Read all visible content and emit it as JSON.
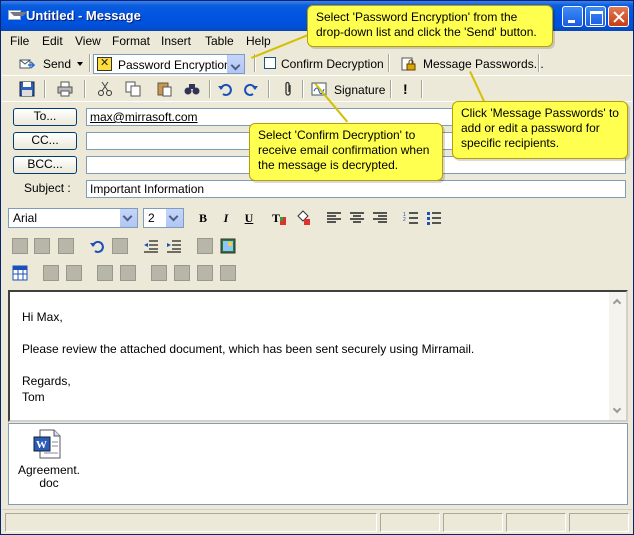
{
  "window": {
    "title": "Untitled - Message"
  },
  "menu": [
    "File",
    "Edit",
    "View",
    "Format",
    "Insert",
    "Table",
    "Help"
  ],
  "toolbar": {
    "send_label": "Send",
    "encryption_selected": "Password Encryption",
    "confirm_decryption_label": "Confirm Decryption",
    "confirm_decryption_checked": false,
    "message_passwords_label": "Message Passwords...",
    "signature_label": "Signature",
    "priority_label": "!"
  },
  "fields": {
    "to_label": "To...",
    "cc_label": "CC...",
    "bcc_label": "BCC...",
    "subject_label": "Subject :",
    "to_value": "max@mirrasoft.com",
    "cc_value": "",
    "bcc_value": "",
    "subject_value": "Important Information"
  },
  "format": {
    "font": "Arial",
    "size": "2",
    "bold": "B",
    "italic": "I",
    "underline": "U"
  },
  "body": {
    "greeting": "Hi Max,",
    "line1": "Please review the attached document, which has been sent securely using Mirramail.",
    "closing": "Regards,",
    "signature": "Tom"
  },
  "attachment": {
    "name": "Agreement.doc"
  },
  "callouts": {
    "encryption": "Select 'Password Encryption' from the drop-down list and click the 'Send' button.",
    "confirm": "Select 'Confirm Decryption' to receive email confirmation when the message is decrypted.",
    "passwords": "Click 'Message Passwords' to add or edit a password for specific recipients."
  },
  "colors": {
    "titlebar": "#0054e3",
    "callout_bg": "#ffff4f",
    "window_bg": "#ece9d8"
  }
}
